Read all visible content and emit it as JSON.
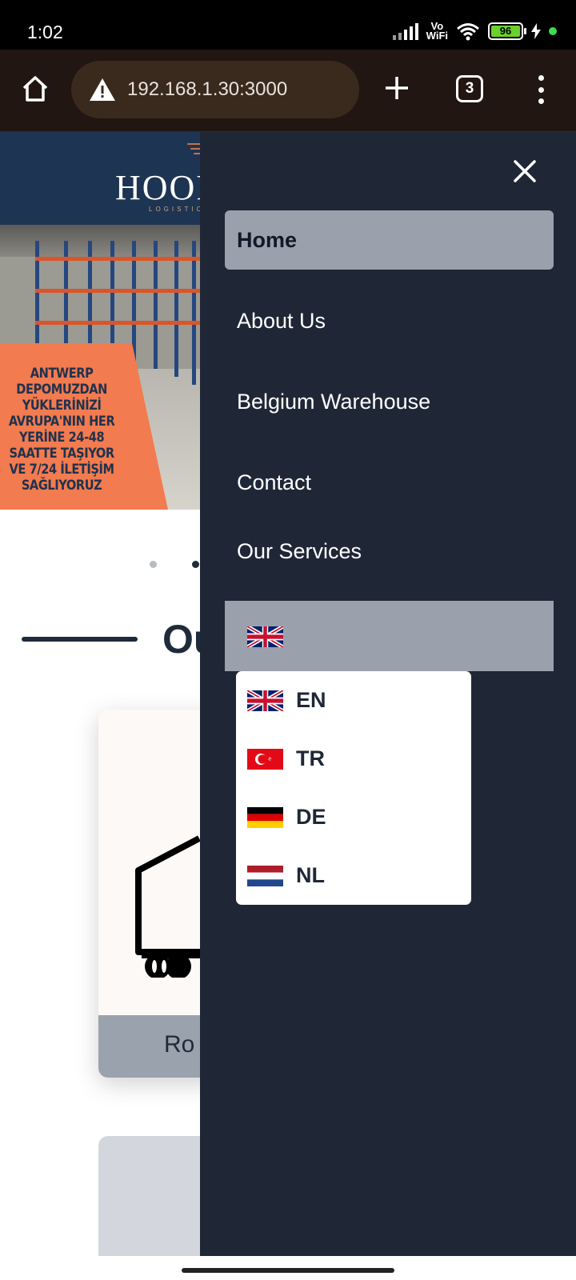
{
  "status_bar": {
    "time": "1:02",
    "network_label_top": "Vo",
    "network_label_bottom": "WiFi",
    "battery_level": "96"
  },
  "browser": {
    "url": "192.168.1.30:3000",
    "tab_count": "3",
    "icons": [
      "home-icon",
      "warning-icon",
      "plus-icon",
      "tab-switcher-icon",
      "more-vert-icon"
    ]
  },
  "background_page": {
    "logo_text": "HOOR",
    "logo_subtext": "LOGISTICS",
    "hero_promo_text": "ANTWERP DEPOMUZDAN YÜKLERİNİZİ AVRUPA'NIN HER YERİNE 24-48 SAATTE TAŞIYOR VE 7/24 İLETİŞİM SAĞLIYORUZ",
    "section_title": "Ou",
    "card_label": "Ro"
  },
  "side_menu": {
    "nav_items": [
      {
        "label": "Home",
        "active": true
      },
      {
        "label": "About Us",
        "active": false
      },
      {
        "label": "Belgium Warehouse",
        "active": false
      },
      {
        "label": "Contact",
        "active": false
      },
      {
        "label": "Our Services",
        "active": false
      }
    ],
    "selected_language_flag": "uk-flag-icon",
    "languages": [
      {
        "code": "EN",
        "flag": "uk-flag-icon"
      },
      {
        "code": "TR",
        "flag": "turkey-flag-icon"
      },
      {
        "code": "DE",
        "flag": "germany-flag-icon"
      },
      {
        "code": "NL",
        "flag": "netherlands-flag-icon"
      }
    ]
  },
  "colors": {
    "menu_bg": "#1f2737",
    "active_item_bg": "#9aa1ad",
    "header_bg": "#1e3453",
    "promo_orange": "#f27b50",
    "toolbar_bg": "#211611"
  }
}
